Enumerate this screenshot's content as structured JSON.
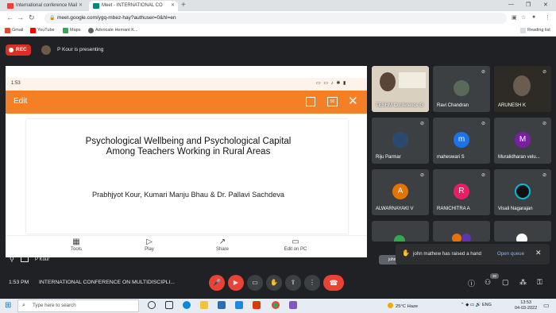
{
  "browser": {
    "tabs": [
      {
        "title": "International conference Mail",
        "icon": "gmail-icon"
      },
      {
        "title": "Meet - INTERNATIONAL CO",
        "icon": "meet-icon"
      }
    ],
    "url": "meet.google.com/ygq-mbez-hay?authuser=0&hl=en",
    "bookmarks": [
      "Gmail",
      "YouTube",
      "Maps",
      "Advocate Hemant K..."
    ],
    "reading_list": "Reading list"
  },
  "meet": {
    "rec_label": "REC",
    "presenting_label": "P Kour is presenting",
    "presenter_name": "P Kour",
    "time": "1:53 PM",
    "meeting_title": "INTERNATIONAL CONFERENCE ON MULTIDISCIPLI...",
    "participant_count": "30"
  },
  "presentation": {
    "phone_time": "1:53",
    "edit_label": "Edit",
    "title_line1": "Psychological Wellbeing and Psychological Capital",
    "title_line2": "Among Teachers Working in Rural Areas",
    "authors": "Prabhjyot Kour, Kumari Manju Bhau & Dr. Pallavi Sachdeva",
    "tools": [
      "Tools",
      "Play",
      "Share",
      "Edit on PC"
    ]
  },
  "tiles": [
    {
      "name": "TESHM Conference G",
      "avatar": "",
      "color": "#d9d0c0"
    },
    {
      "name": "Ravi Chandran",
      "avatar": "",
      "color": "#5a6a5a"
    },
    {
      "name": "ARUNESH K",
      "avatar": "",
      "color": "#6a5c50"
    },
    {
      "name": "Riju Parmar",
      "avatar": "",
      "color": "#2a4a70"
    },
    {
      "name": "maheswari S",
      "avatar": "m",
      "color": "#1a73e8"
    },
    {
      "name": "Muralidharan velu...",
      "avatar": "M",
      "color": "#7b1fa2"
    },
    {
      "name": "ALWARNAYAKI V",
      "avatar": "A",
      "color": "#e37400"
    },
    {
      "name": "RANICHITRA A",
      "avatar": "R",
      "color": "#e91e63"
    },
    {
      "name": "Visali Nagarajan",
      "avatar": "",
      "color": "#00bcd4"
    }
  ],
  "notification": {
    "text": "john mathew has raised a hand",
    "action": "Open queue",
    "tag": "john"
  },
  "taskbar": {
    "search_placeholder": "Type here to search",
    "weather": "25°C  Haze",
    "lang": "ENG",
    "clock_time": "13:53",
    "clock_date": "04-03-2022"
  },
  "colors": {
    "accent_orange": "#f47f25",
    "meet_bg": "#202124",
    "rec_red": "#d93025"
  }
}
